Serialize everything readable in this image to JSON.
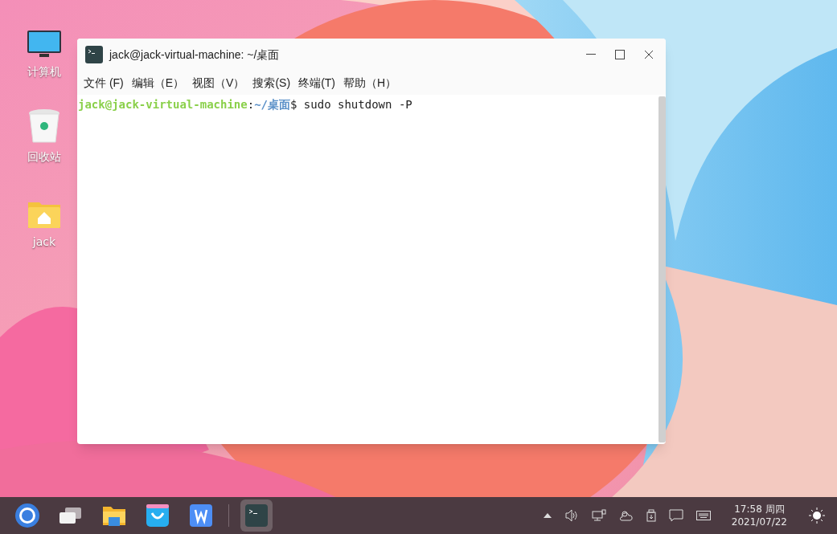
{
  "desktop_icons": [
    {
      "kind": "computer",
      "label": "计算机"
    },
    {
      "kind": "trash",
      "label": "回收站"
    },
    {
      "kind": "home",
      "label": "jack"
    }
  ],
  "window": {
    "title": "jack@jack-virtual-machine: ~/桌面",
    "menu": [
      "文件 (F)",
      "编辑（E）",
      "视图（V）",
      "搜索(S)",
      "终端(T)",
      "帮助（H）"
    ],
    "terminal": {
      "user_host": "jack@jack-virtual-machine",
      "separator": ":",
      "path": "~/桌面",
      "prompt": "$",
      "command": "sudo shutdown -P"
    }
  },
  "taskbar": {
    "apps": [
      {
        "kind": "start",
        "selected": false
      },
      {
        "kind": "windows",
        "selected": false
      },
      {
        "kind": "files",
        "selected": false
      },
      {
        "kind": "store",
        "selected": false
      },
      {
        "kind": "wps",
        "selected": false
      },
      {
        "kind": "terminal",
        "selected": true
      }
    ],
    "clock": {
      "time": "17:58 周四",
      "date": "2021/07/22"
    }
  }
}
